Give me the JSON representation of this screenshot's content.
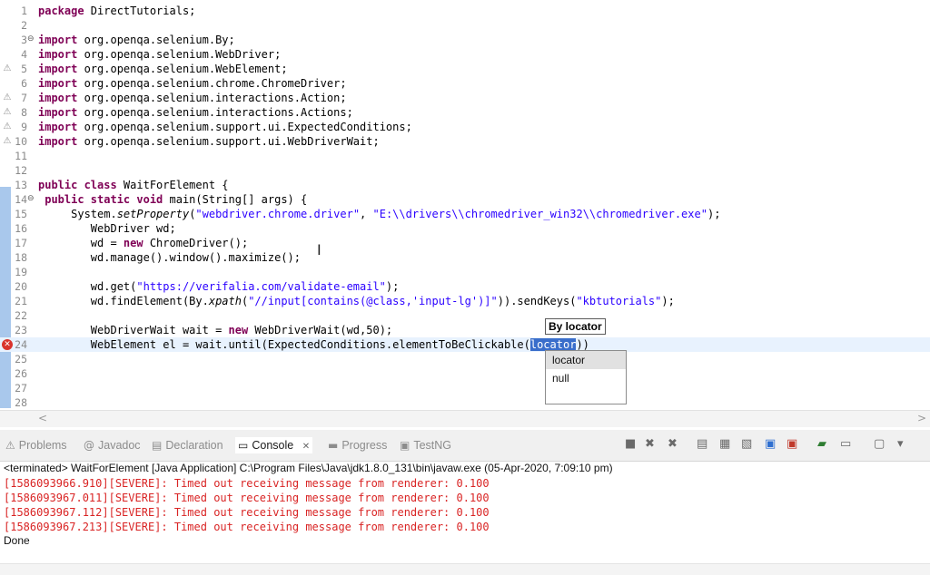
{
  "editor": {
    "lines": [
      {
        "n": "1",
        "code": "<span class=\"kw\">package</span> DirectTutorials;"
      },
      {
        "n": "2",
        "code": ""
      },
      {
        "n": "3",
        "fold": "⊖",
        "code": "<span class=\"kw\">import</span> org.openqa.selenium.By;"
      },
      {
        "n": "4",
        "code": "<span class=\"kw\">import</span> org.openqa.selenium.WebDriver;"
      },
      {
        "n": "5",
        "warn": "⚠",
        "code": "<span class=\"kw\">import</span> org.openqa.selenium.WebElement;"
      },
      {
        "n": "6",
        "code": "<span class=\"kw\">import</span> org.openqa.selenium.chrome.ChromeDriver;"
      },
      {
        "n": "7",
        "warn": "⚠",
        "code": "<span class=\"kw\">import</span> org.openqa.selenium.interactions.Action;"
      },
      {
        "n": "8",
        "warn": "⚠",
        "code": "<span class=\"kw\">import</span> org.openqa.selenium.interactions.Actions;"
      },
      {
        "n": "9",
        "warn": "⚠",
        "code": "<span class=\"kw\">import</span> org.openqa.selenium.support.ui.ExpectedConditions;"
      },
      {
        "n": "10",
        "warn": "⚠",
        "code": "<span class=\"kw\">import</span> org.openqa.selenium.support.ui.WebDriverWait;"
      },
      {
        "n": "11",
        "code": ""
      },
      {
        "n": "12",
        "code": ""
      },
      {
        "n": "13",
        "code": "<span class=\"kw\">public class</span> WaitForElement {"
      },
      {
        "n": "14",
        "fold": "⊖",
        "code": " <span class=\"kw\">public static void</span> main(String[] args) {"
      },
      {
        "n": "15",
        "code": "     System.<span class=\"ital\">setProperty</span>(<span class=\"str\">\"webdriver.chrome.driver\"</span>, <span class=\"str\">\"E:\\\\drivers\\\\chromedriver_win32\\\\chromedriver.exe\"</span>);"
      },
      {
        "n": "16",
        "code": "        WebDriver wd;"
      },
      {
        "n": "17",
        "code": "        wd = <span class=\"kw\">new</span> ChromeDriver();"
      },
      {
        "n": "18",
        "code": "        wd.manage().window().maximize();"
      },
      {
        "n": "19",
        "code": ""
      },
      {
        "n": "20",
        "code": "        wd.get(<span class=\"str\">\"https://verifalia.com/validate-email\"</span>);"
      },
      {
        "n": "21",
        "code": "        wd.findElement(By.<span class=\"ital\">xpath</span>(<span class=\"str\">\"//input[contains(@class,'input-lg')]\"</span>)).sendKeys(<span class=\"str\">\"kbtutorials\"</span>);"
      },
      {
        "n": "22",
        "code": ""
      },
      {
        "n": "23",
        "code": "        WebDriverWait wait = <span class=\"kw\">new</span> WebDriverWait(wd,50);"
      },
      {
        "n": "24",
        "err": "✕",
        "current": true,
        "code": "        WebElement el = wait.until(ExpectedConditions.elementToBeClickable(<span class=\"sel\">locator</span>))"
      },
      {
        "n": "25",
        "code": ""
      },
      {
        "n": "26",
        "code": ""
      },
      {
        "n": "27",
        "code": ""
      },
      {
        "n": "28",
        "code": ""
      }
    ],
    "hint": "By locator",
    "assist_items": [
      "locator",
      "null"
    ],
    "hscroll_left": "<",
    "hscroll_right": ">"
  },
  "views": {
    "tabs": [
      {
        "label": "Problems",
        "icon": "⚠",
        "icon_name": "problems-icon"
      },
      {
        "label": "Javadoc",
        "icon": "@",
        "icon_name": "javadoc-icon"
      },
      {
        "label": "Declaration",
        "icon": "▤",
        "icon_name": "declaration-icon"
      },
      {
        "label": "Console",
        "icon": "▭",
        "icon_name": "console-icon",
        "active": true,
        "close": "✕"
      },
      {
        "label": "Progress",
        "icon": "▬",
        "icon_name": "progress-icon"
      },
      {
        "label": "TestNG",
        "icon": "▣",
        "icon_name": "testng-icon"
      }
    ],
    "toolbar_icons": [
      {
        "name": "terminate-icon",
        "glyph": "■"
      },
      {
        "name": "remove-launch-icon",
        "glyph": "✖"
      },
      {
        "name": "remove-all-terminated-icon",
        "glyph": "✖"
      },
      {
        "name": "clear-console-icon",
        "glyph": "▤"
      },
      {
        "name": "scroll-lock-icon",
        "glyph": "▦"
      },
      {
        "name": "word-wrap-icon",
        "glyph": "▧"
      },
      {
        "name": "show-stdout-icon",
        "glyph": "▣"
      },
      {
        "name": "show-stderr-icon",
        "glyph": "▣"
      },
      {
        "name": "pin-console-icon",
        "glyph": "▰"
      },
      {
        "name": "display-console-icon",
        "glyph": "▭"
      },
      {
        "name": "open-console-icon",
        "glyph": "▢"
      },
      {
        "name": "view-menu-icon",
        "glyph": "▾"
      }
    ],
    "console": {
      "title": "<terminated> WaitForElement [Java Application] C:\\Program Files\\Java\\jdk1.8.0_131\\bin\\javaw.exe (05-Apr-2020, 7:09:10 pm)",
      "lines": [
        "[1586093966.910][SEVERE]: Timed out receiving message from renderer: 0.100",
        "[1586093967.011][SEVERE]: Timed out receiving message from renderer: 0.100",
        "[1586093967.112][SEVERE]: Timed out receiving message from renderer: 0.100",
        "[1586093967.213][SEVERE]: Timed out receiving message from renderer: 0.100"
      ],
      "done": "Done"
    }
  },
  "colors": {
    "keyword": "#7f0055",
    "string": "#2a00ff",
    "selection": "#3a6ecb",
    "console_error": "#d92424"
  }
}
